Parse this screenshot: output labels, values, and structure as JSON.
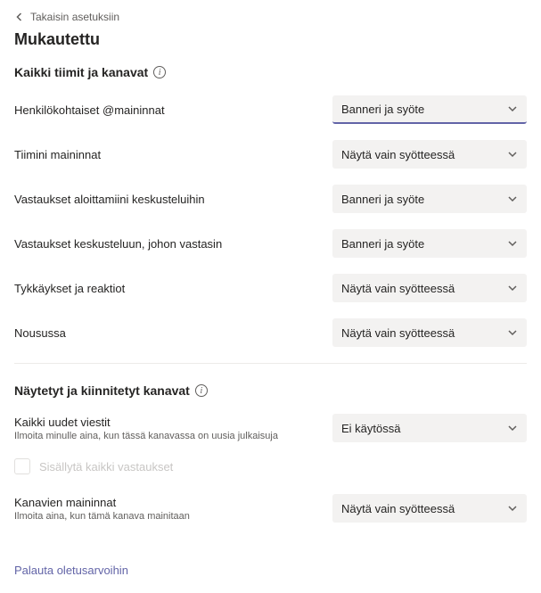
{
  "back_label": "Takaisin asetuksiin",
  "page_title": "Mukautettu",
  "section1": {
    "title": "Kaikki tiimit ja kanavat",
    "rows": [
      {
        "label": "Henkilökohtaiset @maininnat",
        "value": "Banneri ja syöte"
      },
      {
        "label": "Tiimini maininnat",
        "value": "Näytä vain syötteessä"
      },
      {
        "label": "Vastaukset aloittamiini keskusteluihin",
        "value": "Banneri ja syöte"
      },
      {
        "label": "Vastaukset keskusteluun, johon vastasin",
        "value": "Banneri ja syöte"
      },
      {
        "label": "Tykkäykset ja reaktiot",
        "value": "Näytä vain syötteessä"
      },
      {
        "label": "Nousussa",
        "value": "Näytä vain syötteessä"
      }
    ]
  },
  "section2": {
    "title": "Näytetyt ja kiinnitetyt kanavat",
    "row_newmsg": {
      "label": "Kaikki uudet viestit",
      "sub": "Ilmoita minulle aina, kun tässä kanavassa on uusia julkaisuja",
      "value": "Ei käytössä"
    },
    "checkbox_label": "Sisällytä kaikki vastaukset",
    "row_channelmentions": {
      "label": "Kanavien maininnat",
      "sub": "Ilmoita aina, kun tämä kanava mainitaan",
      "value": "Näytä vain syötteessä"
    }
  },
  "reset_label": "Palauta oletusarvoihin"
}
